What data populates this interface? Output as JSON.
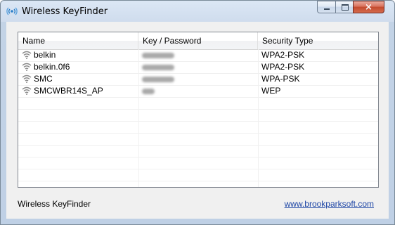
{
  "window": {
    "title": "Wireless KeyFinder",
    "icon": "wireless-antenna-icon",
    "controls": {
      "minimize": "minimize-icon",
      "maximize": "maximize-icon",
      "close": "×"
    }
  },
  "table": {
    "columns": [
      "Name",
      "Key / Password",
      "Security Type"
    ],
    "rows": [
      {
        "name": "belkin",
        "key": "",
        "security": "WPA2-PSK"
      },
      {
        "name": "belkin.0f6",
        "key": "",
        "security": "WPA2-PSK"
      },
      {
        "name": "SMC",
        "key": "",
        "security": "WPA-PSK"
      },
      {
        "name": "SMCWBR14S_AP",
        "key": "",
        "security": "WEP"
      }
    ],
    "row_icon": "wifi-signal-icon",
    "key_display": "blurred"
  },
  "footer": {
    "label": "Wireless KeyFinder",
    "link": "www.brookparksoft.com"
  },
  "colors": {
    "link": "#1f47a6",
    "close_button": "#c44a2e",
    "titlebar": "#cfdced"
  }
}
